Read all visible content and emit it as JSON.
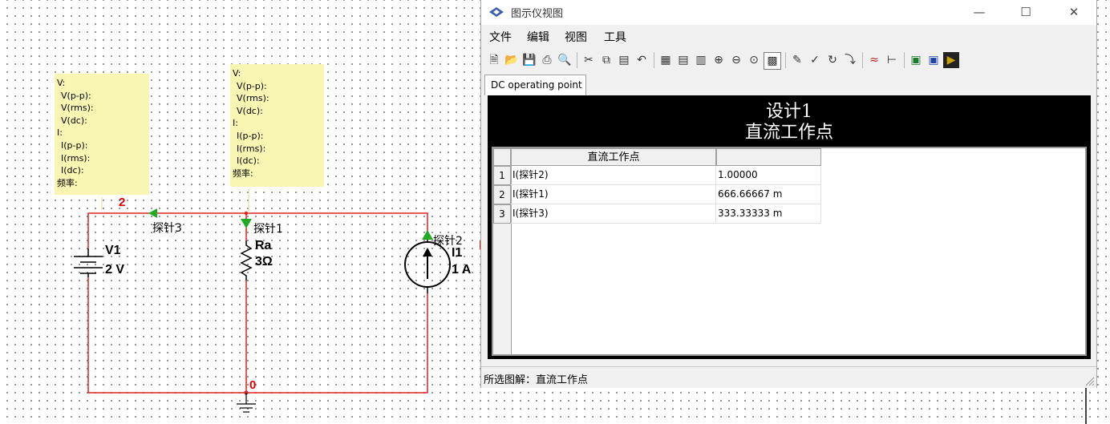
{
  "schematic": {
    "probe_box_left": {
      "lines": [
        "V:",
        "V(p-p):",
        "V(rms):",
        "V(dc):",
        "I:",
        "I(p-p):",
        "I(rms):",
        "I(dc):",
        "频率:"
      ]
    },
    "probe_box_right": {
      "lines": [
        "V:",
        "V(p-p):",
        "V(rms):",
        "V(dc):",
        "I:",
        "I(p-p):",
        "I(rms):",
        "I(dc):",
        "频率:"
      ]
    },
    "node_top": "2",
    "node_ground": "0",
    "probe3": "探针3",
    "probe1": "探针1",
    "probe2": "探针2",
    "v1_name": "V1",
    "v1_value": "2 V",
    "ra_name": "Ra",
    "ra_value": "3Ω",
    "i1_name": "I1",
    "i1_value": "1 A",
    "wire_color": "#e02020",
    "probe_color": "#22aa22"
  },
  "window": {
    "title": "图示仪视图",
    "controls": [
      "minimize",
      "maximize",
      "close"
    ],
    "menu": [
      "文件",
      "编辑",
      "视图",
      "工具"
    ],
    "toolbar_icons": [
      "new-icon",
      "open-icon",
      "save-icon",
      "print-icon",
      "print-preview-icon",
      "cut-icon",
      "copy-icon",
      "paste-icon",
      "undo-icon",
      "grid-icon",
      "legend-icon",
      "cursors-icon",
      "zoom-in-icon",
      "zoom-out-icon",
      "zoom-fit-icon",
      "reverse-colors-icon",
      "properties-icon",
      "select-trace-icon",
      "overlay-icon",
      "export-icon",
      "add-trace-icon",
      "add-cursor-icon",
      "excel-export-icon",
      "mathcad-export-icon",
      "labview-export-icon"
    ],
    "tab": "DC operating point",
    "graph": {
      "title_line1": "设计1",
      "title_line2": "直流工作点",
      "table": {
        "header": "直流工作点",
        "rows": [
          {
            "num": "1",
            "name": "I(探针2)",
            "value": "1.00000"
          },
          {
            "num": "2",
            "name": "I(探针1)",
            "value": "666.66667 m"
          },
          {
            "num": "3",
            "name": "I(探针3)",
            "value": "333.33333 m"
          }
        ]
      }
    },
    "status": "所选图解：直流工作点"
  }
}
